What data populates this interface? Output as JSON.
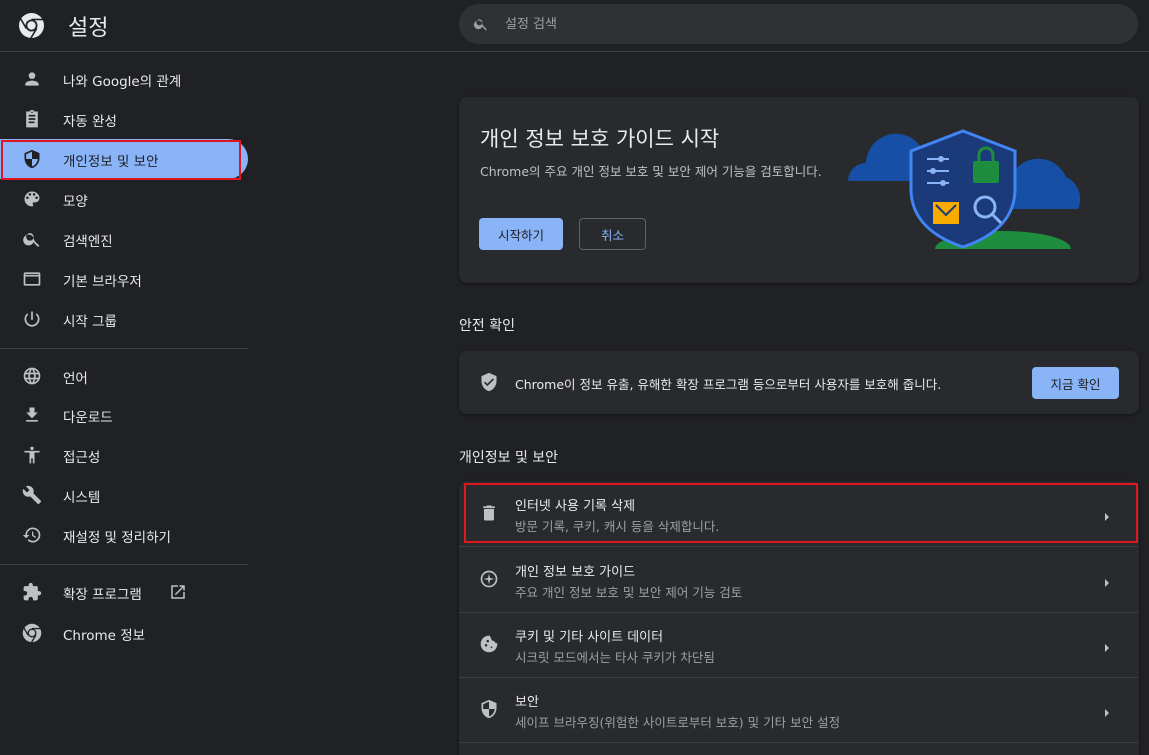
{
  "header": {
    "title": "설정",
    "search_placeholder": "설정 검색"
  },
  "sidebar": {
    "items": [
      {
        "label": "나와 Google의 관계",
        "icon": "person-icon"
      },
      {
        "label": "자동 완성",
        "icon": "clipboard-icon"
      },
      {
        "label": "개인정보 및 보안",
        "icon": "shield-icon",
        "active": true
      },
      {
        "label": "모양",
        "icon": "palette-icon"
      },
      {
        "label": "검색엔진",
        "icon": "search-icon"
      },
      {
        "label": "기본 브라우저",
        "icon": "browser-window-icon"
      },
      {
        "label": "시작 그룹",
        "icon": "power-icon"
      },
      {
        "label": "언어",
        "icon": "globe-icon"
      },
      {
        "label": "다운로드",
        "icon": "download-icon"
      },
      {
        "label": "접근성",
        "icon": "accessibility-icon"
      },
      {
        "label": "시스템",
        "icon": "wrench-icon"
      },
      {
        "label": "재설정 및 정리하기",
        "icon": "restore-icon"
      },
      {
        "label": "확장 프로그램",
        "icon": "puzzle-icon"
      },
      {
        "label": "Chrome 정보",
        "icon": "chrome-logo-icon"
      }
    ]
  },
  "privacy_guide": {
    "title": "개인 정보 보호 가이드 시작",
    "description": "Chrome의 주요 개인 정보 보호 및 보안 제어 기능을 검토합니다.",
    "start_label": "시작하기",
    "cancel_label": "취소"
  },
  "safety_check": {
    "section_title": "안전 확인",
    "text": "Chrome이 정보 유출, 유해한 확장 프로그램 등으로부터 사용자를 보호해 줍니다.",
    "button_label": "지금 확인"
  },
  "privacy_section": {
    "title": "개인정보 및 보안",
    "rows": [
      {
        "title": "인터넷 사용 기록 삭제",
        "subtitle": "방문 기록, 쿠키, 캐시 등을 삭제합니다.",
        "icon": "trash-icon"
      },
      {
        "title": "개인 정보 보호 가이드",
        "subtitle": "주요 개인 정보 보호 및 보안 제어 기능 검토",
        "icon": "compass-icon"
      },
      {
        "title": "쿠키 및 기타 사이트 데이터",
        "subtitle": "시크릿 모드에서는 타사 쿠키가 차단됨",
        "icon": "cookie-icon"
      },
      {
        "title": "보안",
        "subtitle": "세이프 브라우징(위험한 사이트로부터 보호) 및 기타 보안 설정",
        "icon": "shield-icon"
      }
    ]
  },
  "colors": {
    "accent": "#8ab4f8",
    "background": "#202124",
    "card": "#292a2d",
    "highlight_box": "#e0171f"
  }
}
